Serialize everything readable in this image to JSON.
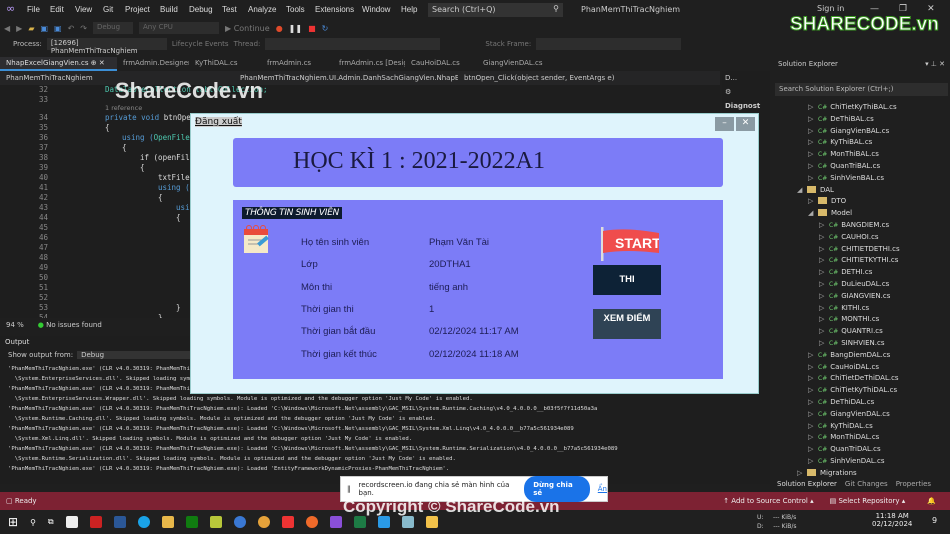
{
  "menu": {
    "items": [
      "File",
      "Edit",
      "View",
      "Git",
      "Project",
      "Build",
      "Debug",
      "Test",
      "Analyze",
      "Tools",
      "Extensions",
      "Window",
      "Help"
    ],
    "search_placeholder": "Search (Ctrl+Q)",
    "app_title": "PhanMemThiTracNghiem",
    "sign_in": "Sign in"
  },
  "toolbar": {
    "config": "Debug",
    "platform": "Any CPU",
    "continue": "Continue"
  },
  "process_bar": {
    "process_label": "Process:",
    "process": "[12696] PhanMemThiTracNghiem",
    "lifecycle": "Lifecycle Events",
    "thread_label": "Thread:",
    "stack_frame_label": "Stack Frame:"
  },
  "tabs": [
    "NhapExcelGiangVien.cs",
    "frmAdmin.Designer.cs",
    "KyThiDAL.cs",
    "frmAdmin.cs",
    "frmAdmin.cs [Design]",
    "CauHoiDAL.cs",
    "GiangVienDAL.cs"
  ],
  "navbar": {
    "project": "PhanMemThiTracNghiem",
    "class": "PhanMemThiTracNghiem.UI.Admin.DanhSachGiangVien.NhapExc",
    "method": "btnOpen_Click(object sender, EventArgs e)"
  },
  "editor": {
    "line_numbers": [
      "32",
      "33",
      "34",
      "35",
      "36",
      "37",
      "38",
      "39",
      "40",
      "41",
      "42",
      "43",
      "44",
      "45",
      "46",
      "47",
      "48",
      "49",
      "50",
      "51",
      "52",
      "53",
      "54"
    ],
    "reference": "1 reference",
    "code": {
      "l32": "DataTableCollection tableCollection;",
      "l34a": "private void ",
      "l34b": "btnOpen",
      "l35": "{",
      "l36a": "using (",
      "l36b": "OpenFile",
      "l37": "{",
      "l38": "if (openFil",
      "l39": "{",
      "l40": "txtFile",
      "l41": "using (",
      "l42": "{",
      "l43": "usi",
      "l44": "{",
      "l53": "}",
      "l54": "}"
    },
    "zoom": "94 %",
    "issues": "No issues found"
  },
  "output": {
    "title": "Output",
    "show_from_label": "Show output from:",
    "source": "Debug",
    "lines": [
      "'PhanMemThiTracNghiem.exe' (CLR v4.0.30319: PhanMemThiTracNghiem.exe): Loaded 'C:\\Windows\\Microsoft.Net\\assembly\\GAC_MSIL\\System.EnterpriseServices",
      "  \\System.EnterpriseServices.dll'. Skipped loading symbols. Module is optimized and the debugger option 'Just My Code' is enabled.",
      "'PhanMemThiTracNghiem.exe' (CLR v4.0.30319: PhanMemThiTracNghiem.exe): Loaded 'C:\\Windows\\Microsoft.Net\\assembly\\GAC_MSIL\\System.EnterpriseServices",
      "  \\System.EnterpriseServices.Wrapper.dll'. Skipped loading symbols. Module is optimized and the debugger option 'Just My Code' is enabled.",
      "'PhanMemThiTracNghiem.exe' (CLR v4.0.30319: PhanMemThiTracNghiem.exe): Loaded 'C:\\Windows\\Microsoft.Net\\assembly\\GAC_MSIL\\System.Runtime.Caching\\v4.0_4.0.0.0__b03f5f7f11d50a3a",
      "  \\System.Runtime.Caching.dll'. Skipped loading symbols. Module is optimized and the debugger option 'Just My Code' is enabled.",
      "'PhanMemThiTracNghiem.exe' (CLR v4.0.30319: PhanMemThiTracNghiem.exe): Loaded 'C:\\Windows\\Microsoft.Net\\assembly\\GAC_MSIL\\System.Xml.Linq\\v4.0_4.0.0.0__b77a5c561934e089",
      "  \\System.Xml.Linq.dll'. Skipped loading symbols. Module is optimized and the debugger option 'Just My Code' is enabled.",
      "'PhanMemThiTracNghiem.exe' (CLR v4.0.30319: PhanMemThiTracNghiem.exe): Loaded 'C:\\Windows\\Microsoft.Net\\assembly\\GAC_MSIL\\System.Runtime.Serialization\\v4.0_4.0.0.0__b77a5c561934e089",
      "  \\System.Runtime.Serialization.dll'. Skipped loading symbols. Module is optimized and the debugger option 'Just My Code' is enabled.",
      "'PhanMemThiTracNghiem.exe' (CLR v4.0.30319: PhanMemThiTracNghiem.exe): Loaded 'EntityFrameworkDynamicProxies-PhanMemThiTracNghiem'."
    ]
  },
  "diagnostics": {
    "title": "D...",
    "label": "Diagnost"
  },
  "solution_explorer": {
    "title": "Solution Explorer",
    "search_placeholder": "Search Solution Explorer (Ctrl+;)",
    "items": [
      {
        "name": "ChiTietKyThiBAL.cs",
        "level": 1,
        "type": "cs"
      },
      {
        "name": "DeThiBAL.cs",
        "level": 1,
        "type": "cs"
      },
      {
        "name": "GiangVienBAL.cs",
        "level": 1,
        "type": "cs"
      },
      {
        "name": "KyThiBAL.cs",
        "level": 1,
        "type": "cs"
      },
      {
        "name": "MonThiBAL.cs",
        "level": 1,
        "type": "cs"
      },
      {
        "name": "QuanTriBAL.cs",
        "level": 1,
        "type": "cs"
      },
      {
        "name": "SinhVienBAL.cs",
        "level": 1,
        "type": "cs"
      },
      {
        "name": "DAL",
        "level": 0,
        "type": "folder-open"
      },
      {
        "name": "DTO",
        "level": 1,
        "type": "folder"
      },
      {
        "name": "Model",
        "level": 1,
        "type": "folder-open"
      },
      {
        "name": "BANGDIEM.cs",
        "level": 2,
        "type": "cs"
      },
      {
        "name": "CAUHOI.cs",
        "level": 2,
        "type": "cs"
      },
      {
        "name": "CHITIETDETHI.cs",
        "level": 2,
        "type": "cs"
      },
      {
        "name": "CHITIETKYTHI.cs",
        "level": 2,
        "type": "cs"
      },
      {
        "name": "DETHI.cs",
        "level": 2,
        "type": "cs"
      },
      {
        "name": "DuLieuDAL.cs",
        "level": 2,
        "type": "cs"
      },
      {
        "name": "GIANGVIEN.cs",
        "level": 2,
        "type": "cs"
      },
      {
        "name": "KITHI.cs",
        "level": 2,
        "type": "cs"
      },
      {
        "name": "MONTHI.cs",
        "level": 2,
        "type": "cs"
      },
      {
        "name": "QUANTRI.cs",
        "level": 2,
        "type": "cs"
      },
      {
        "name": "SINHVIEN.cs",
        "level": 2,
        "type": "cs"
      },
      {
        "name": "BangDiemDAL.cs",
        "level": 1,
        "type": "cs"
      },
      {
        "name": "CauHoiDAL.cs",
        "level": 1,
        "type": "cs"
      },
      {
        "name": "ChiTietDeThiDAL.cs",
        "level": 1,
        "type": "cs"
      },
      {
        "name": "ChiTietKyThiDAL.cs",
        "level": 1,
        "type": "cs"
      },
      {
        "name": "DeThiDAL.cs",
        "level": 1,
        "type": "cs"
      },
      {
        "name": "GiangVienDAL.cs",
        "level": 1,
        "type": "cs"
      },
      {
        "name": "KyThiDAL.cs",
        "level": 1,
        "type": "cs"
      },
      {
        "name": "MonThiDAL.cs",
        "level": 1,
        "type": "cs"
      },
      {
        "name": "QuanTriDAL.cs",
        "level": 1,
        "type": "cs"
      },
      {
        "name": "SinhVienDAL.cs",
        "level": 1,
        "type": "cs"
      },
      {
        "name": "Migrations",
        "level": 0,
        "type": "folder"
      }
    ],
    "bottom_tabs": [
      "Solution Explorer",
      "Git Changes",
      "Properties"
    ]
  },
  "statusbar": {
    "ready": "Ready",
    "add_source": "Add to Source Control",
    "select_repo": "Select Repository"
  },
  "share_bar": {
    "message": "recordscreen.io đang chia sẻ màn hình của bạn.",
    "stop": "Dừng chia sẻ",
    "hide": "Ẩn"
  },
  "taskbar": {
    "time": "11:18 AM",
    "date": "02/12/2024",
    "upload": "U:",
    "download": "D:",
    "up_rate": "--- KiB/s",
    "down_rate": "--- KiB/s",
    "notifications": "9"
  },
  "dialog": {
    "logout": "Đăng xuất",
    "semester": "HỌC KÌ 1 : 2021-2022A1",
    "section": "THÔNG TIN SINH VIÊN",
    "fields": [
      {
        "label": "Họ tên sinh viên",
        "value": "Phạm Văn Tài"
      },
      {
        "label": "Lớp",
        "value": "20DTHA1"
      },
      {
        "label": "Môn thi",
        "value": "tiếng anh"
      },
      {
        "label": "Thời gian thi",
        "value": "1"
      },
      {
        "label": "Thời gian bắt đầu",
        "value": "02/12/2024 11:17 AM"
      },
      {
        "label": "Thời gian kết thúc",
        "value": "02/12/2024 11:18 AM"
      }
    ],
    "start_logo": "START",
    "exam_button": "THI",
    "view_score_button": "XEM ĐIỂM"
  },
  "watermarks": {
    "top": "ShareCode.vn",
    "bottom": "Copyright © ShareCode.vn",
    "logo": "SHARECODE.vn"
  },
  "colors": {
    "dialog_panel": "#7c7cf7",
    "dialog_bg": "#dff4fc",
    "button_dark": "#0d2236",
    "statusbar": "#7d2233"
  }
}
